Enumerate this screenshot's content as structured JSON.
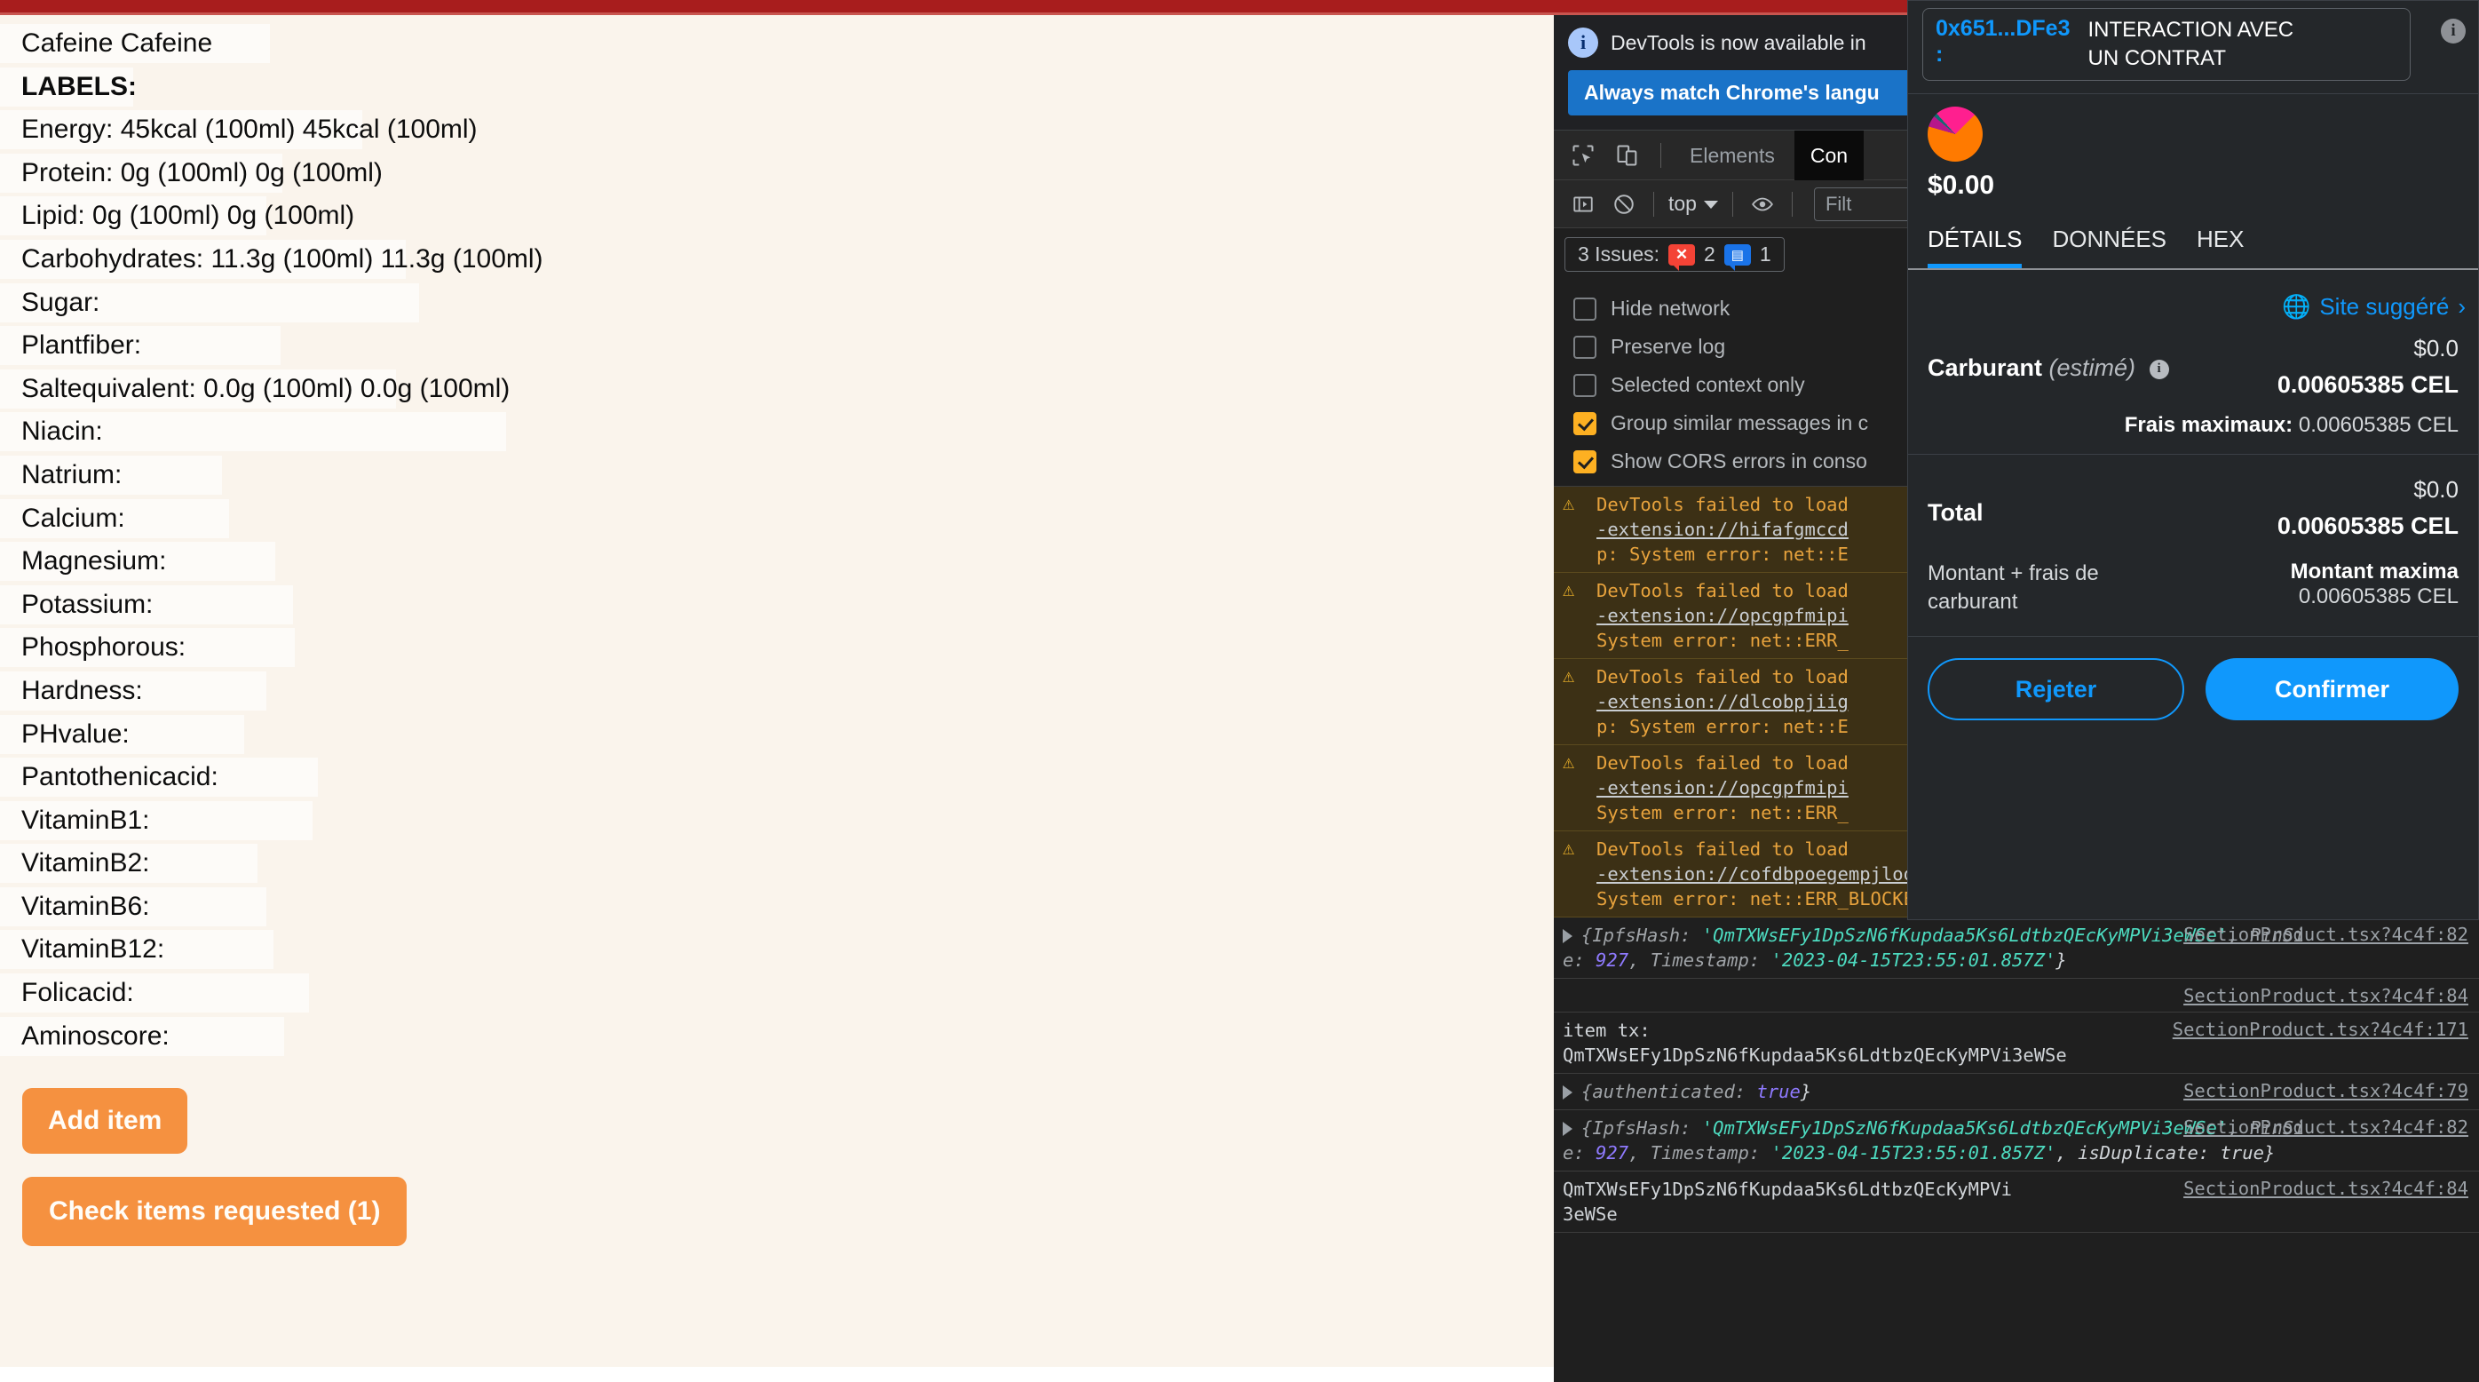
{
  "product": {
    "name": "Cafeine Cafeine",
    "section_title": "LABELS:",
    "rows": [
      {
        "label": "Energy:",
        "value": "45kcal (100ml) 45kcal (100ml)"
      },
      {
        "label": "Protein:",
        "value": "0g (100ml) 0g (100ml)"
      },
      {
        "label": "Lipid:",
        "value": "0g (100ml) 0g (100ml)"
      },
      {
        "label": "Carbohydrates:",
        "value": "11.3g (100ml) 11.3g (100ml)"
      },
      {
        "label": "Sugar:",
        "value": ""
      },
      {
        "label": "Plantfiber:",
        "value": ""
      },
      {
        "label": "Saltequivalent:",
        "value": "0.0g (100ml) 0.0g (100ml)"
      },
      {
        "label": "Niacin:",
        "value": ""
      },
      {
        "label": "Natrium:",
        "value": ""
      },
      {
        "label": "Calcium:",
        "value": ""
      },
      {
        "label": "Magnesium:",
        "value": ""
      },
      {
        "label": "Potassium:",
        "value": ""
      },
      {
        "label": "Phosphorous:",
        "value": ""
      },
      {
        "label": "Hardness:",
        "value": ""
      },
      {
        "label": "PHvalue:",
        "value": ""
      },
      {
        "label": "Pantothenicacid:",
        "value": ""
      },
      {
        "label": "VitaminB1:",
        "value": ""
      },
      {
        "label": "VitaminB2:",
        "value": ""
      },
      {
        "label": "VitaminB6:",
        "value": ""
      },
      {
        "label": "VitaminB12:",
        "value": ""
      },
      {
        "label": "Folicacid:",
        "value": ""
      },
      {
        "label": "Aminoscore:",
        "value": ""
      }
    ],
    "add_item_button": "Add item",
    "check_items_button": "Check items requested (1)",
    "accent_color": "#f59140"
  },
  "devtools": {
    "banner": {
      "message": "DevTools is now available in",
      "action_button": "Always match Chrome's langu",
      "info_icon": "info-icon"
    },
    "tabs": [
      {
        "label": "Elements",
        "active": false
      },
      {
        "label": "Con",
        "active": true
      }
    ],
    "toolbar": {
      "inspect_icon": "inspect-element-icon",
      "device_icon": "device-toolbar-icon",
      "sidebar_icon": "console-sidebar-icon",
      "clear_icon": "clear-console-icon",
      "context": "top",
      "eye_icon": "live-expression-icon",
      "filter_placeholder": "Filt"
    },
    "issues": {
      "label": "3 Issues:",
      "errors": "2",
      "infos": "1"
    },
    "settings": [
      {
        "label": "Hide network",
        "checked": false
      },
      {
        "label": "Preserve log",
        "checked": false
      },
      {
        "label": "Selected context only",
        "checked": false
      },
      {
        "label": "Group similar messages in c",
        "checked": true
      },
      {
        "label": "Show CORS errors in conso",
        "checked": true
      }
    ],
    "checkbox_color": "#fdb022",
    "console": [
      {
        "type": "warning",
        "line1": "DevTools failed to load",
        "link": "-extension://hifafgmccd",
        "line3": "p: System error: net::E"
      },
      {
        "type": "warning",
        "line1": "DevTools failed to load",
        "link": "-extension://opcgpfmipi",
        "line3": "System error: net::ERR_"
      },
      {
        "type": "warning",
        "line1": "DevTools failed to load",
        "link": "-extension://dlcobpjiig",
        "line3": "p: System error: net::E"
      },
      {
        "type": "warning",
        "line1": "DevTools failed to load",
        "link": "-extension://opcgpfmipi",
        "line3": "System error: net::ERR_"
      },
      {
        "type": "warning",
        "line1": "DevTools failed to load",
        "link": "-extension://cofdbpoegempjloogbagkncekinflcnj/build/content.js.map",
        "line3": "System error: net::ERR_BLOCKED_BY_CLIENT"
      },
      {
        "type": "object",
        "prefix": "{IpfsHash: ",
        "hash": "'QmTXWsEFy1DpSzN6fKupdaa5Ks6LdtbzQEcKyMPVi3eWSe'",
        "mid": ", PinSi",
        "line2_prefix": "e: ",
        "num": "927",
        "line2_mid": ", Timestamp: ",
        "timestamp": "'2023-04-15T23:55:01.857Z'",
        "line2_end": "}",
        "source": "SectionProduct.tsx?4c4f:82"
      },
      {
        "type": "blank",
        "source": "SectionProduct.tsx?4c4f:84"
      },
      {
        "type": "text2",
        "line1": "item tx:",
        "line2": "QmTXWsEFy1DpSzN6fKupdaa5Ks6LdtbzQEcKyMPVi3eWSe",
        "source": "SectionProduct.tsx?4c4f:171"
      },
      {
        "type": "authobj",
        "text": "{authenticated: true}",
        "source": "SectionProduct.tsx?4c4f:79"
      },
      {
        "type": "object",
        "prefix": "{IpfsHash: ",
        "hash": "'QmTXWsEFy1DpSzN6fKupdaa5Ks6LdtbzQEcKyMPVi3eWSe'",
        "mid": ", PinSi",
        "line2_prefix": "e: ",
        "num": "927",
        "line2_mid": ", Timestamp: ",
        "timestamp": "'2023-04-15T23:55:01.857Z'",
        "line2_end": ", isDuplicate: true}",
        "source": "SectionProduct.tsx?4c4f:82"
      },
      {
        "type": "text2",
        "line1": "QmTXWsEFy1DpSzN6fKupdaa5Ks6LdtbzQEcKyMPVi",
        "line2": "3eWSe",
        "source": "SectionProduct.tsx?4c4f:84"
      }
    ]
  },
  "metamask": {
    "address": "0x651...DFe3",
    "colon": ":",
    "interaction": "INTERACTION AVEC UN CONTRAT",
    "info_icon": "info-icon",
    "identicon": "account-identicon",
    "amount": "$0.00",
    "tabs": [
      {
        "label": "DÉTAILS",
        "active": true
      },
      {
        "label": "DONNÉES",
        "active": false
      },
      {
        "label": "HEX",
        "active": false
      }
    ],
    "suggested_site": "Site suggéré",
    "globe_icon": "globe-icon",
    "chevron_icon": "chevron-right-icon",
    "fee": {
      "label": "Carburant",
      "estimated": "(estimé)",
      "usd": "$0.0",
      "value": "0.00605385 CEL",
      "max_label": "Frais maximaux:",
      "max_value": "0.00605385 CEL"
    },
    "total": {
      "label": "Total",
      "usd": "$0.0",
      "value": "0.00605385 CEL",
      "sub_label": "Montant + frais de carburant",
      "max_label": "Montant maxima",
      "max_value": "0.00605385 CEL"
    },
    "reject_button": "Rejeter",
    "confirm_button": "Confirmer",
    "accent_color": "#1098fc"
  }
}
